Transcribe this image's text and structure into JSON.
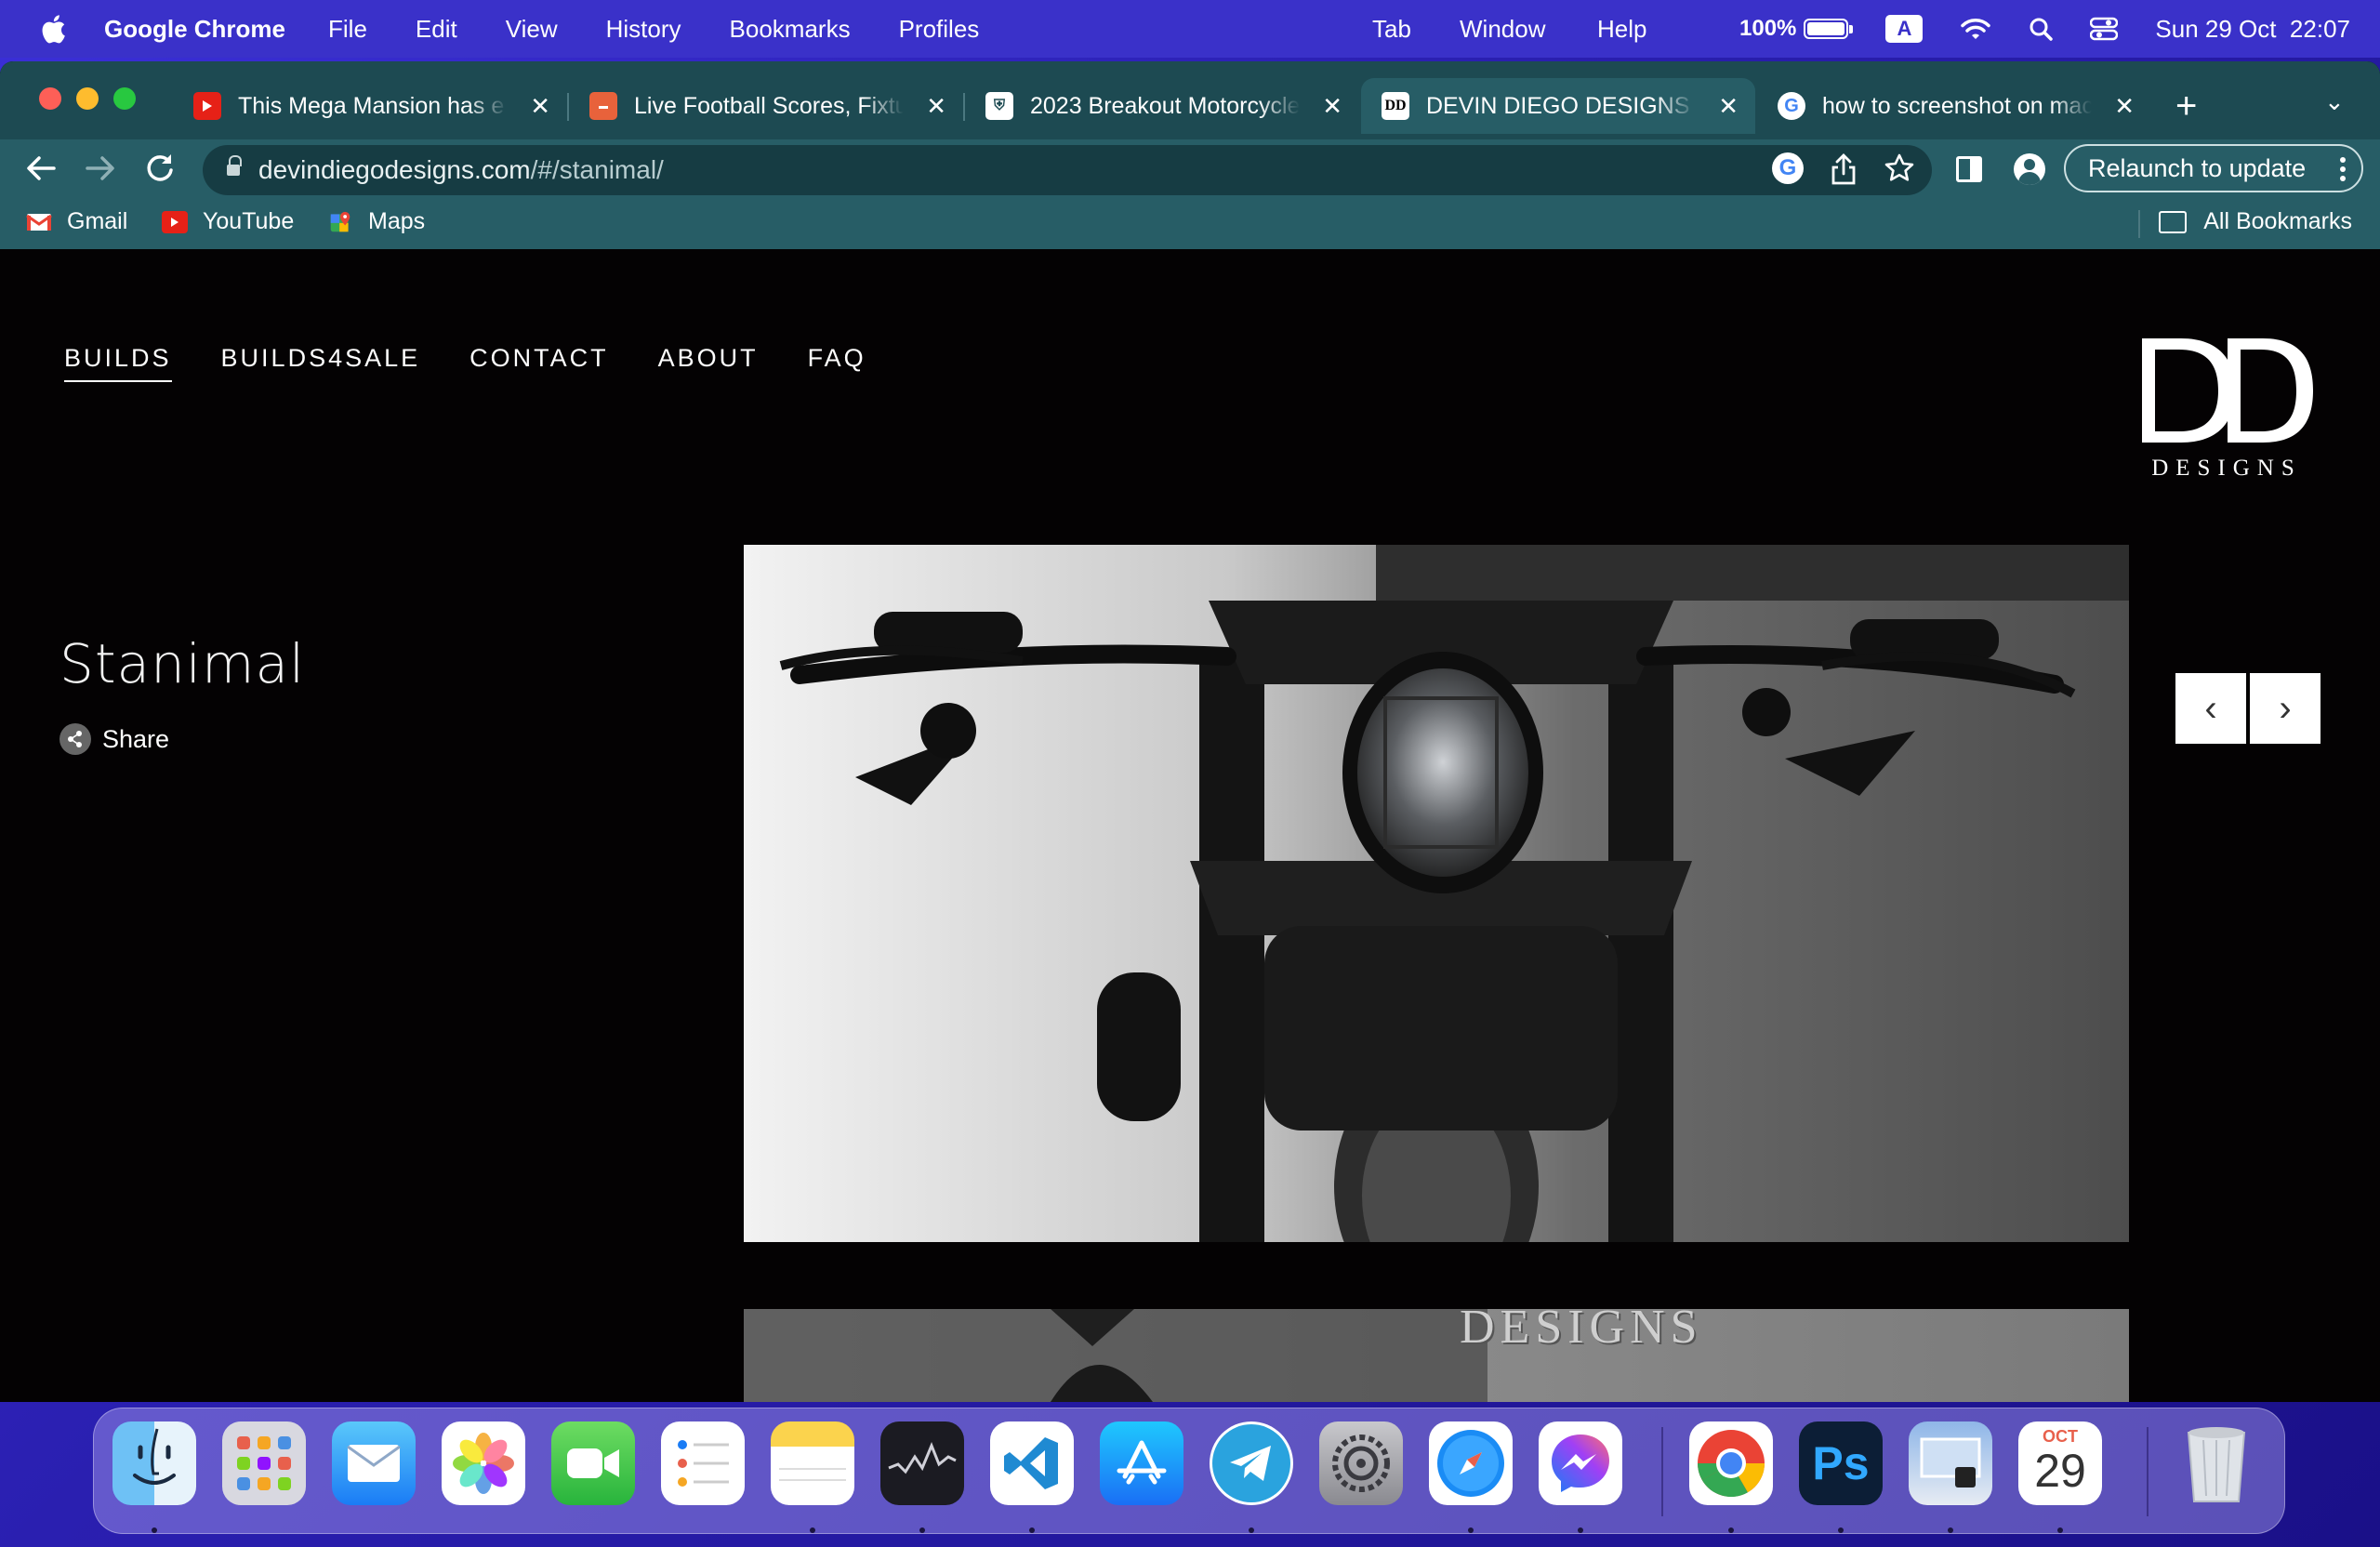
{
  "menubar": {
    "app_name": "Google Chrome",
    "items": [
      "File",
      "Edit",
      "View",
      "History",
      "Bookmarks",
      "Profiles"
    ],
    "right_items": [
      "Tab",
      "Window",
      "Help"
    ],
    "battery_pct": "100%",
    "battery_level": 1.0,
    "input_source": "A",
    "datetime": "Sun 29 Oct  22:07"
  },
  "tabs": [
    {
      "title": "This Mega Mansion has e",
      "favicon": "youtube-icon",
      "color": "#e62117"
    },
    {
      "title": "Live Football Scores, Fixtu",
      "favicon": "livescore-icon",
      "color": "#e8623b"
    },
    {
      "title": "2023 Breakout Motorcycle",
      "favicon": "harley-icon",
      "color": "#ffffff"
    },
    {
      "title": "DEVIN DIEGO DESIGNS – ",
      "favicon": "dd-logo-icon",
      "color": "#ffffff"
    },
    {
      "title": "how to screenshot on mac",
      "favicon": "google-icon",
      "color": "#ffffff"
    }
  ],
  "active_tab_index": 3,
  "toolbar": {
    "url_host": "devindiegodesigns.com",
    "url_path": "/#/stanimal/",
    "relaunch_label": "Relaunch to update"
  },
  "bookmarks": {
    "items": [
      {
        "label": "Gmail",
        "icon": "gmail-icon"
      },
      {
        "label": "YouTube",
        "icon": "youtube-icon"
      },
      {
        "label": "Maps",
        "icon": "maps-icon"
      }
    ],
    "all_label": "All Bookmarks"
  },
  "site": {
    "nav": [
      "BUILDS",
      "BUILDS4SALE",
      "CONTACT",
      "ABOUT",
      "FAQ"
    ],
    "active_nav": "BUILDS",
    "logo_mark": "DD",
    "logo_word": "DESIGNS",
    "build_title": "Stanimal",
    "share_label": "Share",
    "prev_glyph": "‹",
    "next_glyph": "›",
    "lower_photo_text": "DESIGNS"
  },
  "dock": {
    "apps": [
      {
        "name": "Finder",
        "icon": "finder-icon",
        "running": true
      },
      {
        "name": "Launchpad",
        "icon": "launchpad-icon",
        "running": false
      },
      {
        "name": "Mail",
        "icon": "mail-icon",
        "running": false
      },
      {
        "name": "Photos",
        "icon": "photos-icon",
        "running": false
      },
      {
        "name": "FaceTime",
        "icon": "facetime-icon",
        "running": false
      },
      {
        "name": "Reminders",
        "icon": "reminders-icon",
        "running": false
      },
      {
        "name": "Notes",
        "icon": "notes-icon",
        "running": true
      },
      {
        "name": "Stocks",
        "icon": "stocks-icon",
        "running": true
      },
      {
        "name": "Visual Studio Code",
        "icon": "vscode-icon",
        "running": true
      },
      {
        "name": "App Store",
        "icon": "appstore-icon",
        "running": false
      },
      {
        "name": "Telegram",
        "icon": "telegram-icon",
        "running": true
      },
      {
        "name": "System Settings",
        "icon": "settings-icon",
        "running": false
      },
      {
        "name": "Safari",
        "icon": "safari-icon",
        "running": true
      },
      {
        "name": "Messenger",
        "icon": "messenger-icon",
        "running": true
      },
      {
        "name": "Google Chrome",
        "icon": "chrome-icon",
        "running": true
      },
      {
        "name": "Photoshop",
        "icon": "photoshop-icon",
        "running": true
      },
      {
        "name": "Preview",
        "icon": "preview-icon",
        "running": true
      },
      {
        "name": "Calendar",
        "icon": "calendar-icon",
        "running": true
      },
      {
        "name": "Trash",
        "icon": "trash-icon",
        "running": false
      }
    ],
    "photoshop_label": "Ps",
    "calendar_month": "OCT",
    "calendar_day": "29"
  }
}
